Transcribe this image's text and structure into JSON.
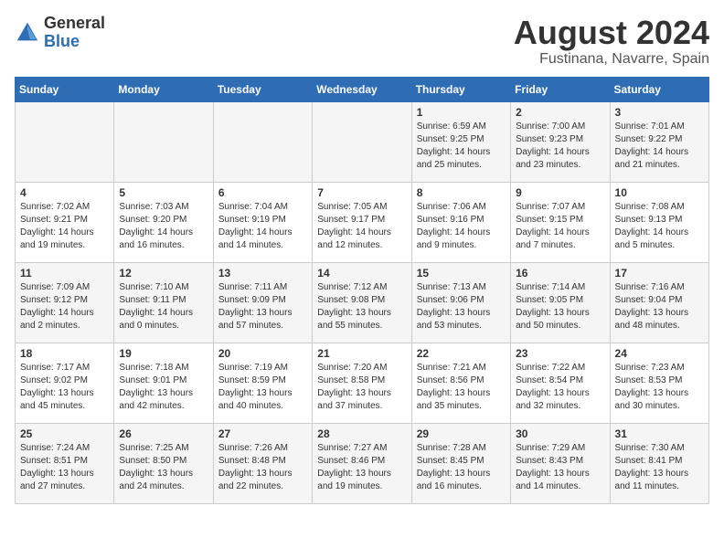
{
  "header": {
    "logo_general": "General",
    "logo_blue": "Blue",
    "month_year": "August 2024",
    "location": "Fustinana, Navarre, Spain"
  },
  "days_of_week": [
    "Sunday",
    "Monday",
    "Tuesday",
    "Wednesday",
    "Thursday",
    "Friday",
    "Saturday"
  ],
  "weeks": [
    [
      {
        "day": "",
        "info": ""
      },
      {
        "day": "",
        "info": ""
      },
      {
        "day": "",
        "info": ""
      },
      {
        "day": "",
        "info": ""
      },
      {
        "day": "1",
        "info": "Sunrise: 6:59 AM\nSunset: 9:25 PM\nDaylight: 14 hours\nand 25 minutes."
      },
      {
        "day": "2",
        "info": "Sunrise: 7:00 AM\nSunset: 9:23 PM\nDaylight: 14 hours\nand 23 minutes."
      },
      {
        "day": "3",
        "info": "Sunrise: 7:01 AM\nSunset: 9:22 PM\nDaylight: 14 hours\nand 21 minutes."
      }
    ],
    [
      {
        "day": "4",
        "info": "Sunrise: 7:02 AM\nSunset: 9:21 PM\nDaylight: 14 hours\nand 19 minutes."
      },
      {
        "day": "5",
        "info": "Sunrise: 7:03 AM\nSunset: 9:20 PM\nDaylight: 14 hours\nand 16 minutes."
      },
      {
        "day": "6",
        "info": "Sunrise: 7:04 AM\nSunset: 9:19 PM\nDaylight: 14 hours\nand 14 minutes."
      },
      {
        "day": "7",
        "info": "Sunrise: 7:05 AM\nSunset: 9:17 PM\nDaylight: 14 hours\nand 12 minutes."
      },
      {
        "day": "8",
        "info": "Sunrise: 7:06 AM\nSunset: 9:16 PM\nDaylight: 14 hours\nand 9 minutes."
      },
      {
        "day": "9",
        "info": "Sunrise: 7:07 AM\nSunset: 9:15 PM\nDaylight: 14 hours\nand 7 minutes."
      },
      {
        "day": "10",
        "info": "Sunrise: 7:08 AM\nSunset: 9:13 PM\nDaylight: 14 hours\nand 5 minutes."
      }
    ],
    [
      {
        "day": "11",
        "info": "Sunrise: 7:09 AM\nSunset: 9:12 PM\nDaylight: 14 hours\nand 2 minutes."
      },
      {
        "day": "12",
        "info": "Sunrise: 7:10 AM\nSunset: 9:11 PM\nDaylight: 14 hours\nand 0 minutes."
      },
      {
        "day": "13",
        "info": "Sunrise: 7:11 AM\nSunset: 9:09 PM\nDaylight: 13 hours\nand 57 minutes."
      },
      {
        "day": "14",
        "info": "Sunrise: 7:12 AM\nSunset: 9:08 PM\nDaylight: 13 hours\nand 55 minutes."
      },
      {
        "day": "15",
        "info": "Sunrise: 7:13 AM\nSunset: 9:06 PM\nDaylight: 13 hours\nand 53 minutes."
      },
      {
        "day": "16",
        "info": "Sunrise: 7:14 AM\nSunset: 9:05 PM\nDaylight: 13 hours\nand 50 minutes."
      },
      {
        "day": "17",
        "info": "Sunrise: 7:16 AM\nSunset: 9:04 PM\nDaylight: 13 hours\nand 48 minutes."
      }
    ],
    [
      {
        "day": "18",
        "info": "Sunrise: 7:17 AM\nSunset: 9:02 PM\nDaylight: 13 hours\nand 45 minutes."
      },
      {
        "day": "19",
        "info": "Sunrise: 7:18 AM\nSunset: 9:01 PM\nDaylight: 13 hours\nand 42 minutes."
      },
      {
        "day": "20",
        "info": "Sunrise: 7:19 AM\nSunset: 8:59 PM\nDaylight: 13 hours\nand 40 minutes."
      },
      {
        "day": "21",
        "info": "Sunrise: 7:20 AM\nSunset: 8:58 PM\nDaylight: 13 hours\nand 37 minutes."
      },
      {
        "day": "22",
        "info": "Sunrise: 7:21 AM\nSunset: 8:56 PM\nDaylight: 13 hours\nand 35 minutes."
      },
      {
        "day": "23",
        "info": "Sunrise: 7:22 AM\nSunset: 8:54 PM\nDaylight: 13 hours\nand 32 minutes."
      },
      {
        "day": "24",
        "info": "Sunrise: 7:23 AM\nSunset: 8:53 PM\nDaylight: 13 hours\nand 30 minutes."
      }
    ],
    [
      {
        "day": "25",
        "info": "Sunrise: 7:24 AM\nSunset: 8:51 PM\nDaylight: 13 hours\nand 27 minutes."
      },
      {
        "day": "26",
        "info": "Sunrise: 7:25 AM\nSunset: 8:50 PM\nDaylight: 13 hours\nand 24 minutes."
      },
      {
        "day": "27",
        "info": "Sunrise: 7:26 AM\nSunset: 8:48 PM\nDaylight: 13 hours\nand 22 minutes."
      },
      {
        "day": "28",
        "info": "Sunrise: 7:27 AM\nSunset: 8:46 PM\nDaylight: 13 hours\nand 19 minutes."
      },
      {
        "day": "29",
        "info": "Sunrise: 7:28 AM\nSunset: 8:45 PM\nDaylight: 13 hours\nand 16 minutes."
      },
      {
        "day": "30",
        "info": "Sunrise: 7:29 AM\nSunset: 8:43 PM\nDaylight: 13 hours\nand 14 minutes."
      },
      {
        "day": "31",
        "info": "Sunrise: 7:30 AM\nSunset: 8:41 PM\nDaylight: 13 hours\nand 11 minutes."
      }
    ]
  ]
}
